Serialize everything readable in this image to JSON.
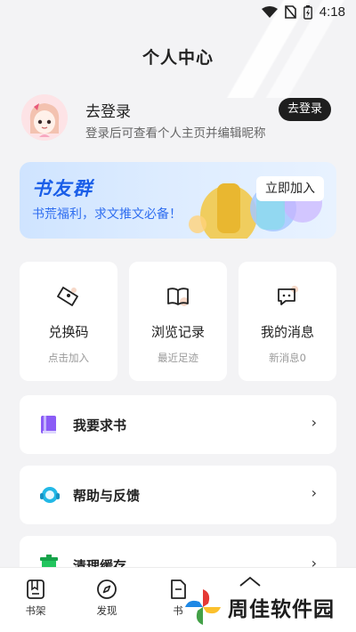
{
  "status_bar": {
    "time": "4:18"
  },
  "header": {
    "title": "个人中心"
  },
  "profile": {
    "title": "去登录",
    "subtitle": "登录后可查看个人主页并编辑昵称",
    "login_button": "去登录"
  },
  "banner": {
    "title": "书友群",
    "subtitle": "书荒福利，求文推文必备！",
    "join_button": "立即加入"
  },
  "quick_cards": [
    {
      "label": "兑换码",
      "sub": "点击加入",
      "icon": "ticket-icon"
    },
    {
      "label": "浏览记录",
      "sub": "最近足迹",
      "icon": "book-open-icon"
    },
    {
      "label": "我的消息",
      "sub": "新消息0",
      "icon": "message-icon"
    }
  ],
  "menu_rows": [
    {
      "label": "我要求书",
      "icon": "book-request-icon"
    },
    {
      "label": "帮助与反馈",
      "icon": "headset-icon"
    },
    {
      "label": "清理缓存",
      "icon": "trash-icon"
    }
  ],
  "bottom_nav": [
    {
      "label": "书架",
      "icon": "bookshelf-icon"
    },
    {
      "label": "发现",
      "icon": "compass-icon"
    },
    {
      "label": "书",
      "icon": "book-icon"
    }
  ],
  "watermark": {
    "text": "周佳软件园"
  },
  "colors": {
    "accent": "#1a5ee8",
    "dark_button": "#1e1e1e",
    "background": "#f3f3f5"
  }
}
